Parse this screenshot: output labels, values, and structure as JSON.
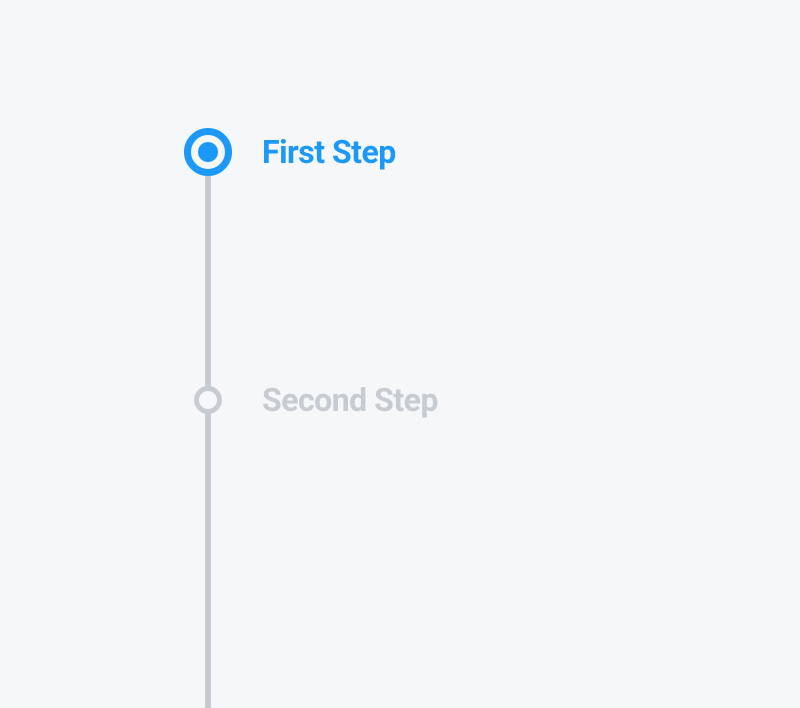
{
  "stepper": {
    "steps": [
      {
        "label": "First Step",
        "state": "active"
      },
      {
        "label": "Second Step",
        "state": "inactive"
      }
    ]
  },
  "colors": {
    "active": "#1c98f7",
    "inactive": "#c6ccd1",
    "background": "#f5f7f9"
  }
}
